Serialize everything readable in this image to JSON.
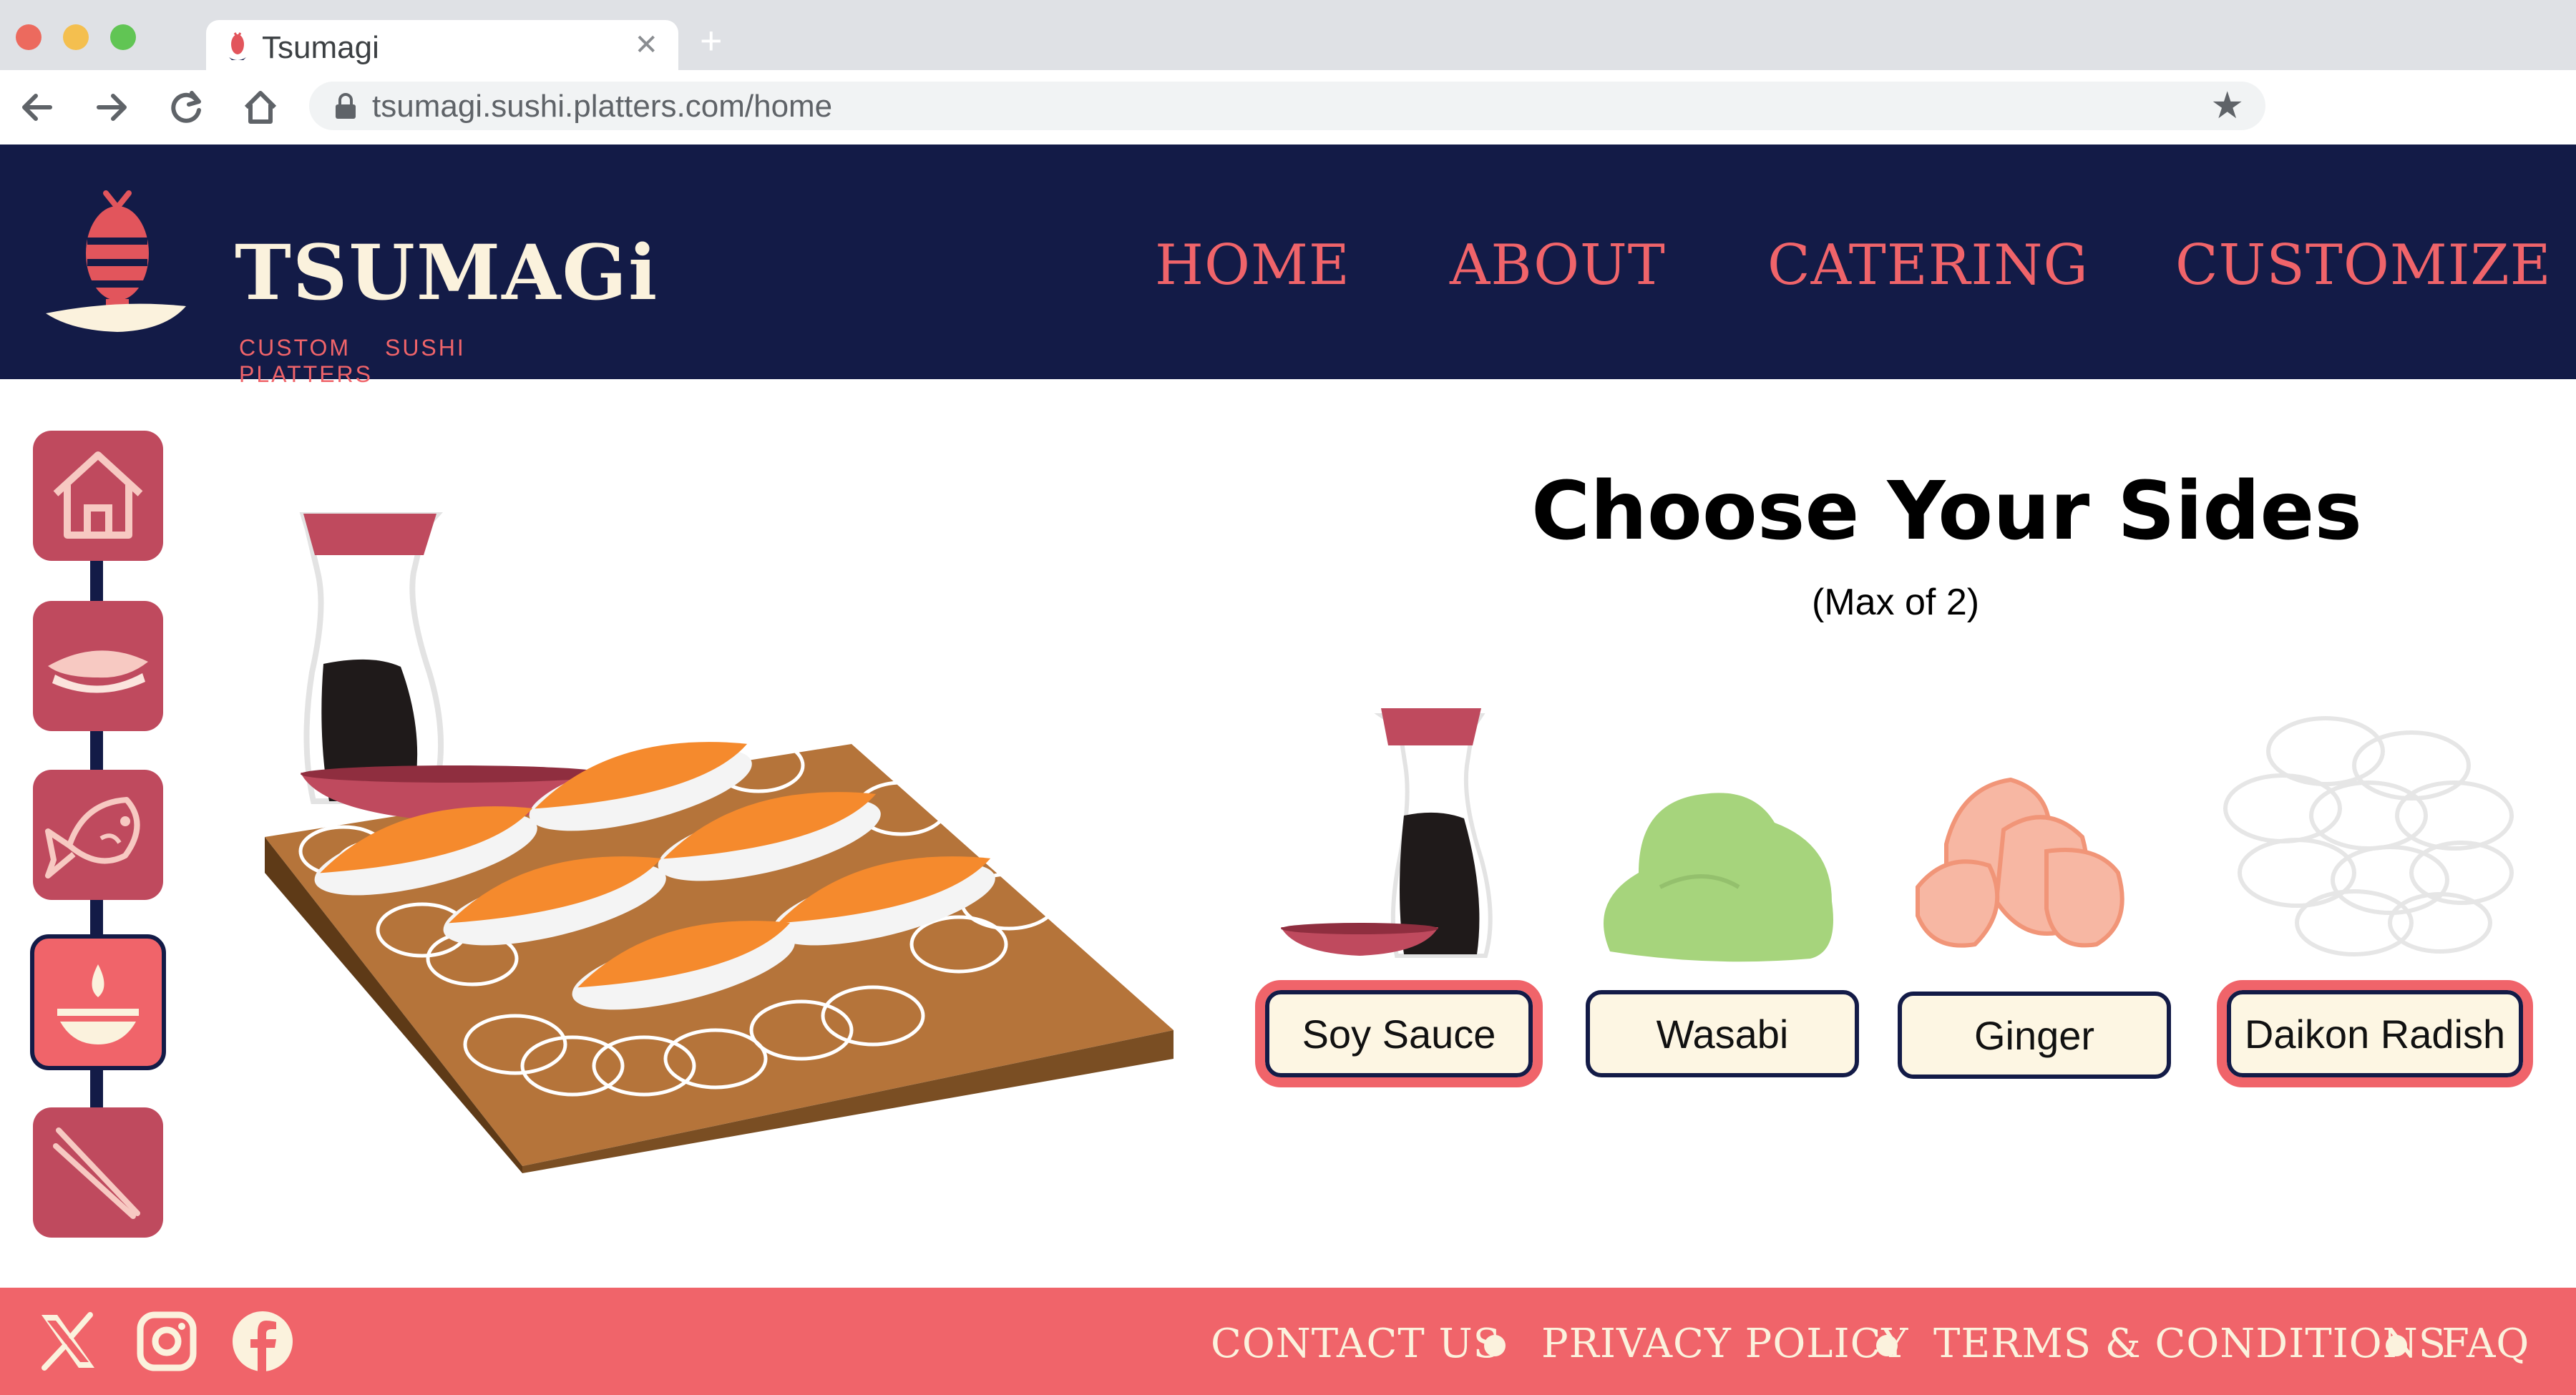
{
  "browser": {
    "tab_title": "Tsumagi",
    "url": "tsumagi.sushi.platters.com/home"
  },
  "brand": {
    "name": "TSUMAGi",
    "tagline": "CUSTOM SUSHI PLATTERS"
  },
  "nav": {
    "items": [
      {
        "label": "HOME"
      },
      {
        "label": "ABOUT"
      },
      {
        "label": "CATERING"
      },
      {
        "label": "CUSTOMIZE"
      }
    ]
  },
  "side_nav": {
    "items": [
      {
        "icon": "home-icon"
      },
      {
        "icon": "nigiri-icon"
      },
      {
        "icon": "fish-icon"
      },
      {
        "icon": "soy-dish-icon",
        "active": true
      },
      {
        "icon": "chopsticks-icon"
      }
    ]
  },
  "main": {
    "title": "Choose Your Sides",
    "subtitle": "(Max of 2)",
    "options": [
      {
        "label": "Soy Sauce",
        "selected": true
      },
      {
        "label": "Wasabi",
        "selected": false
      },
      {
        "label": "Ginger",
        "selected": false
      },
      {
        "label": "Daikon Radish",
        "selected": true
      }
    ]
  },
  "footer": {
    "social": [
      "x-icon",
      "instagram-icon",
      "facebook-icon"
    ],
    "links": [
      {
        "label": "CONTACT US"
      },
      {
        "label": "PRIVACY POLICY"
      },
      {
        "label": "TERMS & CONDITIONS"
      },
      {
        "label": "FAQ"
      }
    ]
  },
  "colors": {
    "navy": "#131b47",
    "coral": "#f0646a",
    "rose": "#bf4a5e",
    "cream": "#fdf6e3"
  }
}
